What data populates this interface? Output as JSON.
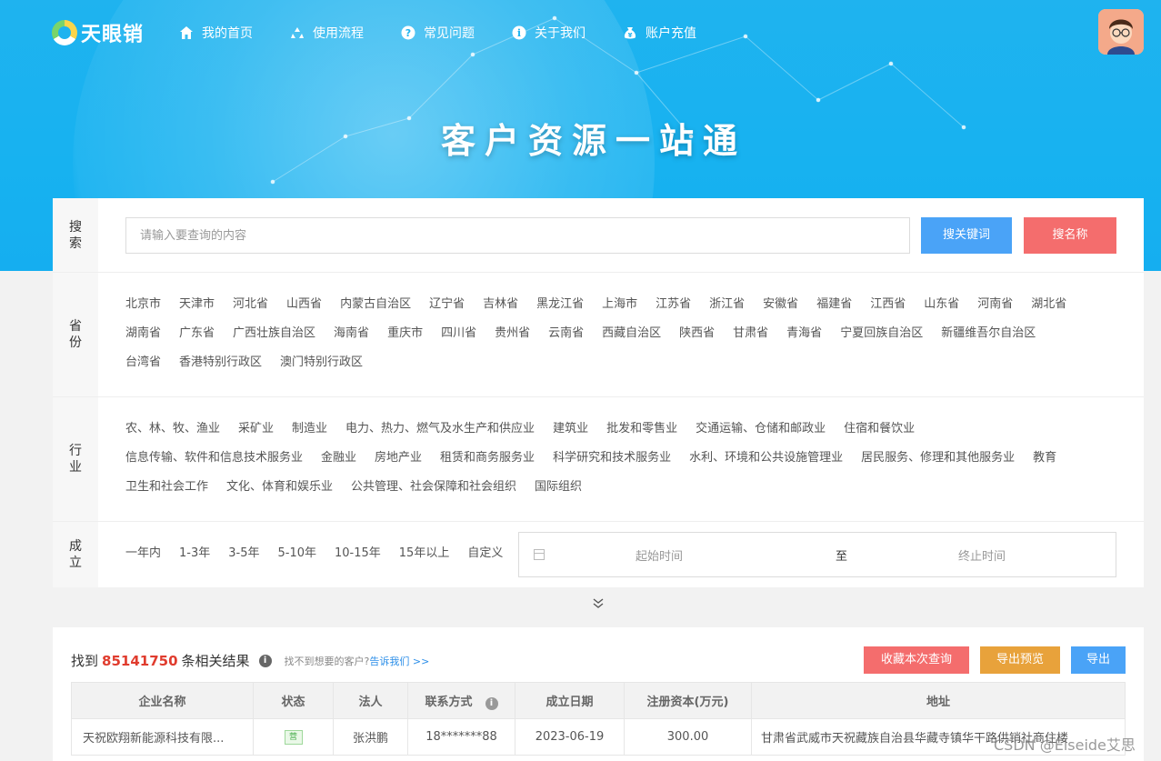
{
  "header": {
    "logo_text": "天眼销",
    "nav": [
      {
        "label": "我的首页",
        "icon": "home-icon"
      },
      {
        "label": "使用流程",
        "icon": "recycle-icon"
      },
      {
        "label": "常见问题",
        "icon": "question-icon"
      },
      {
        "label": "关于我们",
        "icon": "info-icon"
      },
      {
        "label": "账户充值",
        "icon": "moneybag-icon"
      }
    ],
    "hero_title": "客户资源一站通"
  },
  "search": {
    "label_1": "搜",
    "label_2": "索",
    "placeholder": "请输入要查询的内容",
    "keyword_button": "搜关键词",
    "name_button": "搜名称"
  },
  "province": {
    "label_1": "省",
    "label_2": "份",
    "items": [
      "北京市",
      "天津市",
      "河北省",
      "山西省",
      "内蒙古自治区",
      "辽宁省",
      "吉林省",
      "黑龙江省",
      "上海市",
      "江苏省",
      "浙江省",
      "安徽省",
      "福建省",
      "江西省",
      "山东省",
      "河南省",
      "湖北省",
      "湖南省",
      "广东省",
      "广西壮族自治区",
      "海南省",
      "重庆市",
      "四川省",
      "贵州省",
      "云南省",
      "西藏自治区",
      "陕西省",
      "甘肃省",
      "青海省",
      "宁夏回族自治区",
      "新疆维吾尔自治区",
      "台湾省",
      "香港特别行政区",
      "澳门特别行政区"
    ]
  },
  "industry": {
    "label_1": "行",
    "label_2": "业",
    "items": [
      "农、林、牧、渔业",
      "采矿业",
      "制造业",
      "电力、热力、燃气及水生产和供应业",
      "建筑业",
      "批发和零售业",
      "交通运输、仓储和邮政业",
      "住宿和餐饮业",
      "信息传输、软件和信息技术服务业",
      "金融业",
      "房地产业",
      "租赁和商务服务业",
      "科学研究和技术服务业",
      "水利、环境和公共设施管理业",
      "居民服务、修理和其他服务业",
      "教育",
      "卫生和社会工作",
      "文化、体育和娱乐业",
      "公共管理、社会保障和社会组织",
      "国际组织"
    ]
  },
  "established": {
    "label_1": "成",
    "label_2": "立",
    "options": [
      "一年内",
      "1-3年",
      "3-5年",
      "5-10年",
      "10-15年",
      "15年以上",
      "自定义"
    ],
    "start_placeholder": "起始时间",
    "separator": "至",
    "end_placeholder": "终止时间"
  },
  "results": {
    "prefix": "找到",
    "count": "85141750",
    "suffix": "条相关结果",
    "hint_text": "找不到想要的客户?",
    "hint_link": "告诉我们 >>",
    "buttons": {
      "save": "收藏本次查询",
      "preview": "导出预览",
      "export": "导出"
    },
    "columns": [
      "企业名称",
      "状态",
      "法人",
      "联系方式",
      "成立日期",
      "注册资本(万元)",
      "地址"
    ],
    "rows": [
      {
        "name": "天祝欧翔新能源科技有限...",
        "status": "营",
        "legal": "张洪鹏",
        "contact": "18*******88",
        "date": "2023-06-19",
        "capital": "300.00",
        "address": "甘肃省武威市天祝藏族自治县华藏寺镇华干路供销社商住楼"
      }
    ]
  },
  "watermark": "CSDN @Elseide艾思",
  "colors": {
    "hero": "#1fb3ef",
    "primary_blue": "#4aa3f7",
    "red": "#f46d6d",
    "orange": "#e8a23b",
    "count_red": "#e03c2e"
  }
}
